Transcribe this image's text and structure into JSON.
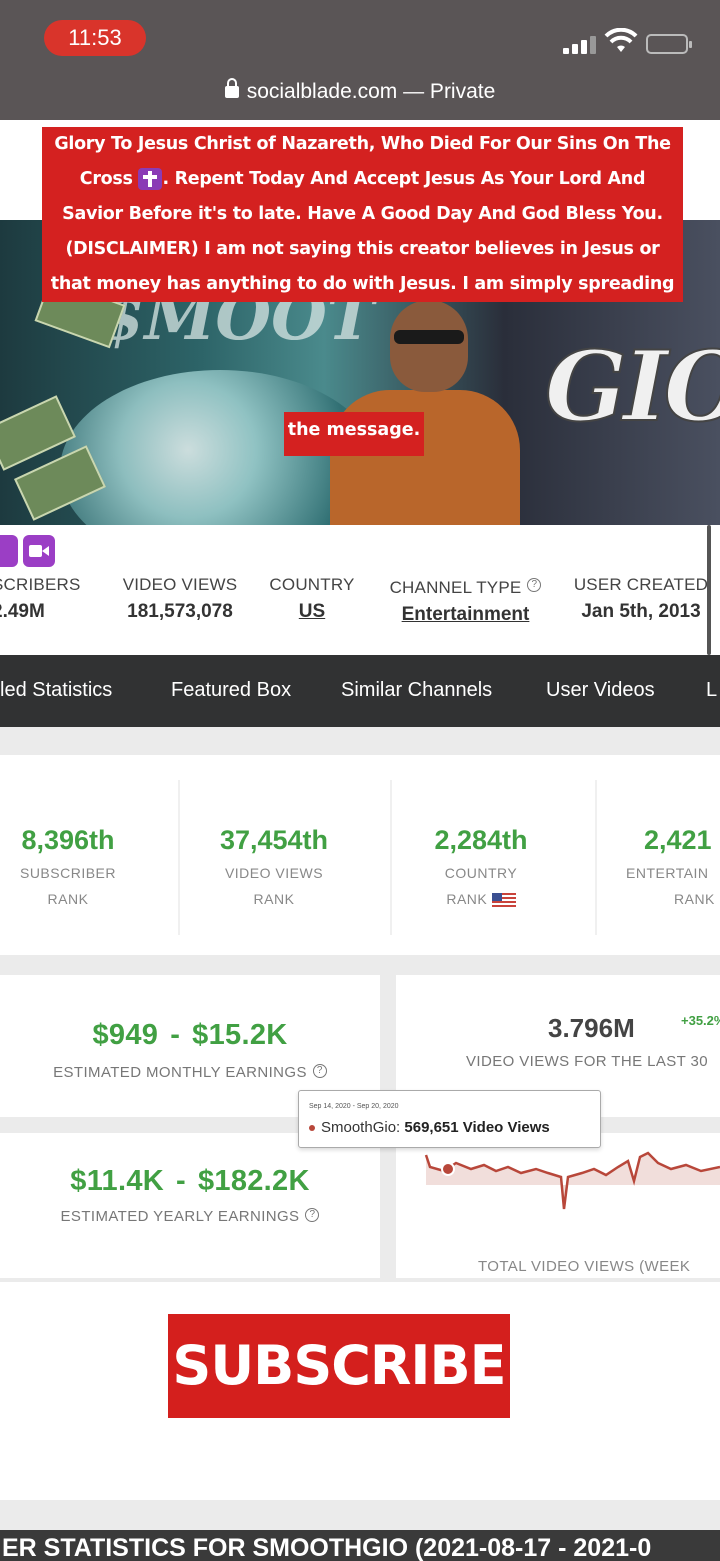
{
  "status_bar": {
    "time": "11:53"
  },
  "url_bar": {
    "text": "socialblade.com — Private"
  },
  "callout": {
    "line1": "Glory To Jesus Christ of Nazareth, Who Died For Our Sins On The",
    "line2a": "Cross",
    "line2b": ". Repent Today And Accept Jesus As Your Lord And",
    "line3": "Savior Before it's to late. Have A Good Day And God Bless You.",
    "line4": "(DISCLAIMER) I am not saying this creator believes in Jesus or",
    "line5": "that money has anything to do with Jesus. I am simply spreading",
    "line6": "the message."
  },
  "banner": {
    "gio_text": "GIO",
    "smooth_text": "$MOOT"
  },
  "channel_stats": [
    {
      "label": "SCRIBERS",
      "value": "2.49M"
    },
    {
      "label": "VIDEO VIEWS",
      "value": "181,573,078"
    },
    {
      "label": "COUNTRY",
      "value": "US"
    },
    {
      "label": "CHANNEL TYPE",
      "value": "Entertainment"
    },
    {
      "label": "USER CREATED",
      "value": "Jan 5th, 2013"
    }
  ],
  "nav": [
    "led Statistics",
    "Featured Box",
    "Similar Channels",
    "User Videos",
    "L"
  ],
  "ranks": [
    {
      "num": "8,396th",
      "l1": "SUBSCRIBER",
      "l2": "RANK"
    },
    {
      "num": "37,454th",
      "l1": "VIDEO VIEWS",
      "l2": "RANK"
    },
    {
      "num": "2,284th",
      "l1": "COUNTRY",
      "l2": "RANK"
    },
    {
      "num": "2,421",
      "l1": "ENTERTAIN",
      "l2": "RANK"
    }
  ],
  "monthly": {
    "low": "$949",
    "high": "$15.2K",
    "caption": "ESTIMATED MONTHLY EARNINGS"
  },
  "yearly": {
    "low": "$11.4K",
    "high": "$182.2K",
    "caption": "ESTIMATED YEARLY EARNINGS"
  },
  "views30": {
    "value": "3.796M",
    "change": "+35.2%",
    "caption": "VIDEO VIEWS FOR THE LAST 30"
  },
  "weekly_chart": {
    "caption": "TOTAL VIDEO VIEWS (WEEK",
    "tooltip_date": "Sep 14, 2020 - Sep 20, 2020",
    "tooltip_series": "SmoothGio:",
    "tooltip_value": "569,651 Video Views",
    "line_color": "#b8473a"
  },
  "subscribe": {
    "label": "SUBSCRIBE"
  },
  "footer": {
    "text": "ER STATISTICS FOR SMOOTHGIO (2021-08-17 - 2021-0"
  },
  "colors": {
    "accent_green": "#41a043",
    "brand_red": "#d42120",
    "nav_bg": "#313233"
  }
}
